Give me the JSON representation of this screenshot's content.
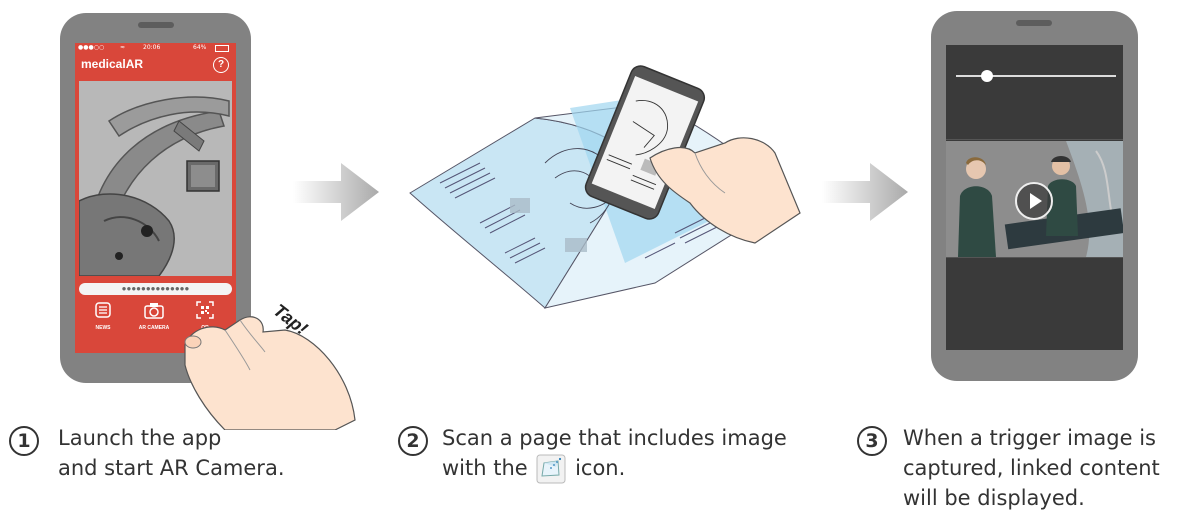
{
  "phone1": {
    "status_time": "20:06",
    "status_battery": "64%",
    "app_title": "medicalAR",
    "help_glyph": "?",
    "progress_text": "●●●●●●●●●●●●●●",
    "tabs": [
      {
        "label": "NEWS",
        "icon": "news-icon"
      },
      {
        "label": "AR CAMERA",
        "icon": "camera-icon"
      },
      {
        "label": "QR",
        "icon": "qr-icon"
      }
    ],
    "accent": "#d9473a"
  },
  "tap_label": "Tap!",
  "steps": [
    {
      "number": "1",
      "line1": "Launch the app",
      "line2": "and start AR Camera."
    },
    {
      "number": "2",
      "line1": "Scan a page that includes image",
      "line2_before": "with the",
      "line2_after": "icon."
    },
    {
      "number": "3",
      "line1": "When a trigger image is",
      "line2": "captured, linked content",
      "line3": "will be displayed."
    }
  ],
  "arrow_color": "#bdbdbd"
}
